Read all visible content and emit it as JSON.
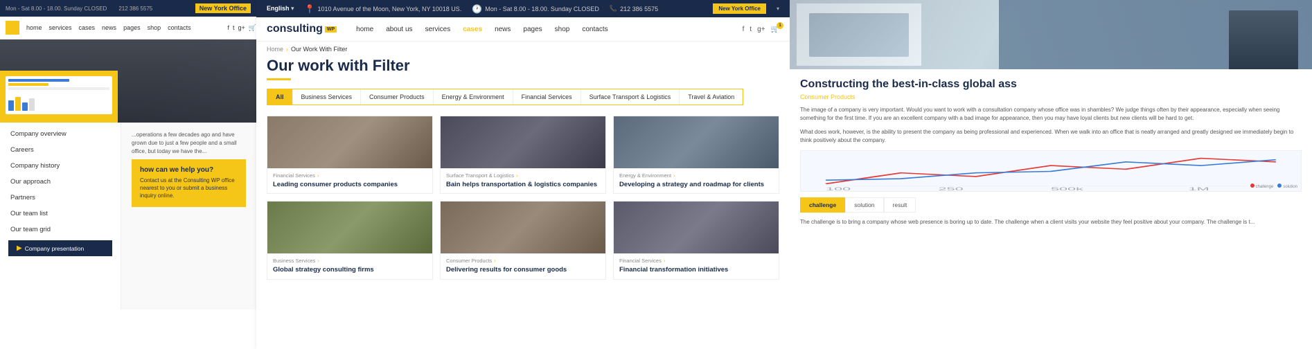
{
  "left": {
    "topbar": {
      "schedule": "Mon - Sat 8.00 - 18.00. Sunday CLOSED",
      "phone": "212 386 5575",
      "office_btn": "New York Office"
    },
    "nav": {
      "items": [
        "home",
        "services",
        "cases",
        "news",
        "pages",
        "shop",
        "contacts"
      ]
    },
    "sidebar_menu": {
      "items": [
        {
          "label": "Company overview",
          "active": false
        },
        {
          "label": "Careers",
          "active": false
        },
        {
          "label": "Company history",
          "active": false
        },
        {
          "label": "Our approach",
          "active": false
        },
        {
          "label": "Partners",
          "active": false
        },
        {
          "label": "Our team list",
          "active": false
        },
        {
          "label": "Our team grid",
          "active": false
        }
      ],
      "cta_label": "Company presentation"
    },
    "how_help": {
      "title": "how can we help you?",
      "text": "Contact us at the Consulting WP office nearest to you or submit a business inquiry online."
    }
  },
  "middle": {
    "topbar": {
      "lang": "English",
      "address": "1010 Avenue of the Moon, New York, NY 10018 US.",
      "schedule": "Mon - Sat 8.00 - 18.00. Sunday CLOSED",
      "phone": "212 386 5575",
      "office_btn": "New York Office"
    },
    "nav": {
      "logo": "consulting",
      "logo_wp": "WP",
      "items": [
        {
          "label": "home",
          "active": false
        },
        {
          "label": "about us",
          "active": false
        },
        {
          "label": "services",
          "active": false
        },
        {
          "label": "cases",
          "active": true
        },
        {
          "label": "news",
          "active": false
        },
        {
          "label": "pages",
          "active": false
        },
        {
          "label": "shop",
          "active": false
        },
        {
          "label": "contacts",
          "active": false
        }
      ],
      "social": [
        "f",
        "t",
        "g+"
      ],
      "cart_count": "1"
    },
    "breadcrumb": {
      "home": "Home",
      "separator": "›",
      "current": "Our Work With Filter"
    },
    "page_title": "Our work with Filter",
    "filters": [
      {
        "label": "All",
        "active": true
      },
      {
        "label": "Business Services",
        "active": false
      },
      {
        "label": "Consumer Products",
        "active": false
      },
      {
        "label": "Energy & Environment",
        "active": false
      },
      {
        "label": "Financial Services",
        "active": false
      },
      {
        "label": "Surface Transport & Logistics",
        "active": false
      },
      {
        "label": "Travel & Aviation",
        "active": false
      }
    ],
    "cases": [
      {
        "category": "Financial Services",
        "title": "Leading consumer products companies",
        "img_class": "case-img-1"
      },
      {
        "category": "Surface Transport & Logistics",
        "title": "Bain helps transportation & logistics companies",
        "img_class": "case-img-2"
      },
      {
        "category": "Energy & Environment",
        "title": "Developing a strategy and roadmap for clients",
        "img_class": "case-img-3"
      },
      {
        "category": "Business Services",
        "title": "Global strategy consulting firms",
        "img_class": "case-img-4"
      },
      {
        "category": "Consumer Products",
        "title": "Delivering results for consumer goods",
        "img_class": "case-img-5"
      },
      {
        "category": "Financial Services",
        "title": "Financial transformation initiatives",
        "img_class": "case-img-6"
      }
    ]
  },
  "right": {
    "title": "Constructing the best-in-class global ass",
    "subtitle": "Consumer Products",
    "body1": "The image of a company is very important. Would you want to work with a consultation company whose office was in shambles? We judge things often by their appearance, especially when seeing something for the first time. If you are an excellent company with a bad image for appearance, then you may have loyal clients but new clients will be hard to get.",
    "body2": "What does work, however, is the ability to present the company as being professional and experienced. When we walk into an office that is neatly arranged and greatly designed we immediately begin to think positively about the company.",
    "chart": {
      "labels": [
        "100",
        "250",
        "500k",
        "1M"
      ],
      "legend": [
        {
          "color": "#e53935",
          "label": "challenge"
        },
        {
          "color": "#3a7bd5",
          "label": "solution"
        }
      ]
    },
    "tabs": [
      {
        "label": "challenge",
        "active": true
      },
      {
        "label": "solution",
        "active": false
      },
      {
        "label": "result",
        "active": false
      }
    ],
    "tab_content": "The challenge is to bring a company whose web presence is boring up to date. The challenge when a client visits your website they feel positive about your company. The challenge is t..."
  }
}
